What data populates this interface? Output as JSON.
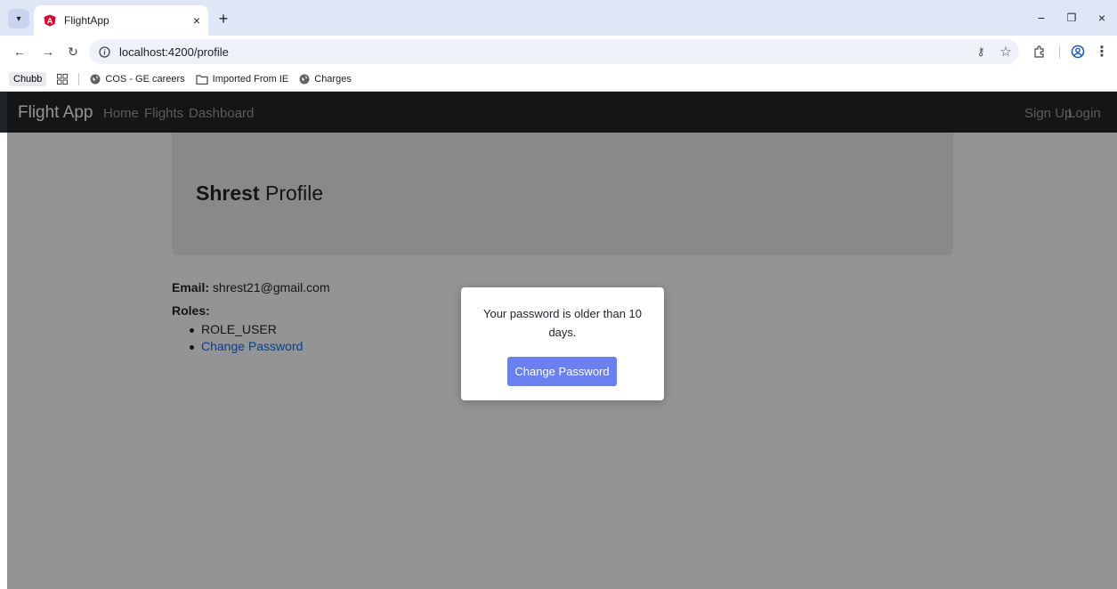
{
  "browser": {
    "tab": {
      "title": "FlightApp",
      "close_glyph": "×"
    },
    "new_tab_glyph": "+",
    "window_controls": {
      "minimize": "−",
      "restore": "❐",
      "close": "×"
    },
    "address_bar": {
      "url": "localhost:4200/profile"
    },
    "bookmarks": {
      "chubb": "Chubb",
      "items": [
        "COS - GE careers",
        "Imported From IE",
        "Charges"
      ]
    }
  },
  "app": {
    "brand": "Flight App",
    "nav_left": [
      "Home",
      "Flights",
      "Dashboard"
    ],
    "nav_right": [
      "Sign Up",
      "Login"
    ]
  },
  "profile": {
    "username": "Shrest",
    "heading_suffix": "Profile",
    "email_label": "Email:",
    "email": "shrest21@gmail.com",
    "roles_label": "Roles:",
    "roles": [
      "ROLE_USER"
    ],
    "change_password_link": "Change Password"
  },
  "modal": {
    "message": "Your password is older than 10 days.",
    "button_label": "Change Password"
  },
  "colors": {
    "navbar_bg": "#212529",
    "modal_button": "#6b80ef",
    "link": "#0d6efd"
  }
}
